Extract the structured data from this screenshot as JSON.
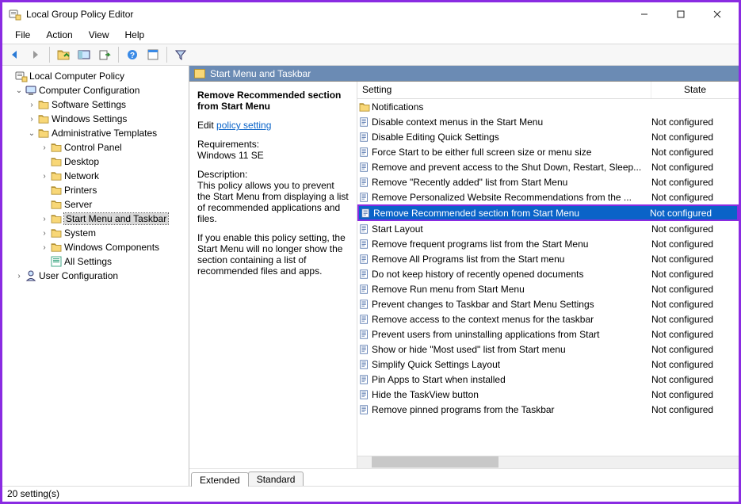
{
  "window": {
    "title": "Local Group Policy Editor"
  },
  "menu": {
    "file": "File",
    "action": "Action",
    "view": "View",
    "help": "Help"
  },
  "crumb": "Start Menu and Taskbar",
  "tree": {
    "root": "Local Computer Policy",
    "cc": "Computer Configuration",
    "ss": "Software Settings",
    "ws": "Windows Settings",
    "at": "Administrative Templates",
    "cp": "Control Panel",
    "dk": "Desktop",
    "nw": "Network",
    "pr": "Printers",
    "sv": "Server",
    "smt": "Start Menu and Taskbar",
    "sy": "System",
    "wc": "Windows Components",
    "as": "All Settings",
    "uc": "User Configuration"
  },
  "desc": {
    "title": "Remove Recommended section from Start Menu",
    "editLabel": "Edit",
    "editLink": "policy setting",
    "reqLabel": "Requirements:",
    "reqText": "Windows 11 SE",
    "dLabel": "Description:",
    "dText": "This policy allows you to prevent the Start Menu from displaying a list of recommended applications and files.",
    "dText2": "If you enable this policy setting, the Start Menu will no longer show the section containing a list of recommended files and apps."
  },
  "grid": {
    "hSetting": "Setting",
    "hState": "State",
    "items": [
      {
        "name": "Notifications",
        "state": "",
        "type": "folder"
      },
      {
        "name": "Disable context menus in the Start Menu",
        "state": "Not configured",
        "type": "pol"
      },
      {
        "name": "Disable Editing Quick Settings",
        "state": "Not configured",
        "type": "pol"
      },
      {
        "name": "Force Start to be either full screen size or menu size",
        "state": "Not configured",
        "type": "pol"
      },
      {
        "name": "Remove and prevent access to the Shut Down, Restart, Sleep...",
        "state": "Not configured",
        "type": "pol"
      },
      {
        "name": "Remove \"Recently added\" list from Start Menu",
        "state": "Not configured",
        "type": "pol"
      },
      {
        "name": "Remove Personalized Website Recommendations from the ...",
        "state": "Not configured",
        "type": "pol"
      },
      {
        "name": "Remove Recommended section from Start Menu",
        "state": "Not configured",
        "type": "pol",
        "selected": true
      },
      {
        "name": "Start Layout",
        "state": "Not configured",
        "type": "pol"
      },
      {
        "name": "Remove frequent programs list from the Start Menu",
        "state": "Not configured",
        "type": "pol"
      },
      {
        "name": "Remove All Programs list from the Start menu",
        "state": "Not configured",
        "type": "pol"
      },
      {
        "name": "Do not keep history of recently opened documents",
        "state": "Not configured",
        "type": "pol"
      },
      {
        "name": "Remove Run menu from Start Menu",
        "state": "Not configured",
        "type": "pol"
      },
      {
        "name": "Prevent changes to Taskbar and Start Menu Settings",
        "state": "Not configured",
        "type": "pol"
      },
      {
        "name": "Remove access to the context menus for the taskbar",
        "state": "Not configured",
        "type": "pol"
      },
      {
        "name": "Prevent users from uninstalling applications from Start",
        "state": "Not configured",
        "type": "pol"
      },
      {
        "name": "Show or hide \"Most used\" list from Start menu",
        "state": "Not configured",
        "type": "pol"
      },
      {
        "name": "Simplify Quick Settings Layout",
        "state": "Not configured",
        "type": "pol"
      },
      {
        "name": "Pin Apps to Start when installed",
        "state": "Not configured",
        "type": "pol"
      },
      {
        "name": "Hide the TaskView button",
        "state": "Not configured",
        "type": "pol"
      },
      {
        "name": "Remove pinned programs from the Taskbar",
        "state": "Not configured",
        "type": "pol"
      }
    ]
  },
  "tabs": {
    "ext": "Extended",
    "std": "Standard"
  },
  "status": "20 setting(s)"
}
